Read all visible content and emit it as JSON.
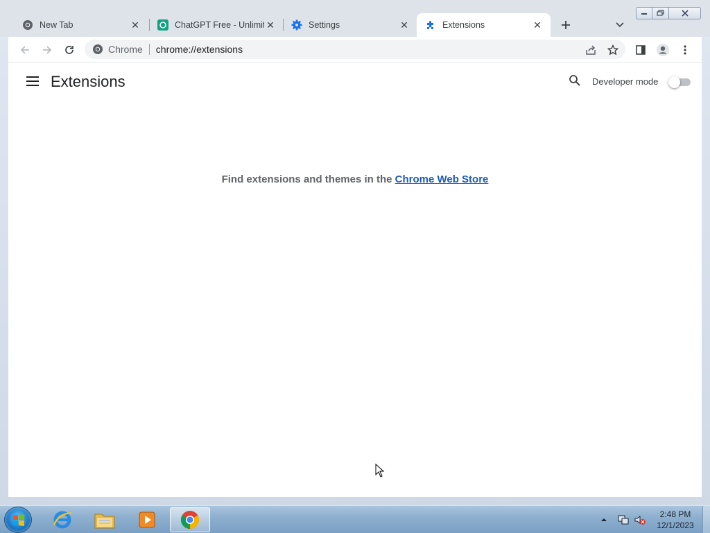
{
  "tabs": [
    {
      "title": "New Tab",
      "icon": "chrome-icon"
    },
    {
      "title": "ChatGPT Free - Unlimited",
      "icon": "chatgpt-icon"
    },
    {
      "title": "Settings",
      "icon": "settings-gear-icon"
    },
    {
      "title": "Extensions",
      "icon": "puzzle-piece-icon",
      "active": true
    }
  ],
  "omnibox": {
    "chip": "Chrome",
    "url": "chrome://extensions"
  },
  "page": {
    "title": "Extensions",
    "developer_mode_label": "Developer mode",
    "developer_mode_enabled": false,
    "empty_text": "Find extensions and themes in the ",
    "store_link": "Chrome Web Store"
  },
  "taskbar": {
    "time": "2:48 PM",
    "date": "12/1/2023",
    "pinned": [
      "internet-explorer-icon",
      "file-explorer-icon",
      "media-player-icon",
      "chrome-icon"
    ]
  },
  "colors": {
    "accent": "#1a73e8",
    "link": "#1e5bb8",
    "tabstrip": "#dee3ea"
  }
}
